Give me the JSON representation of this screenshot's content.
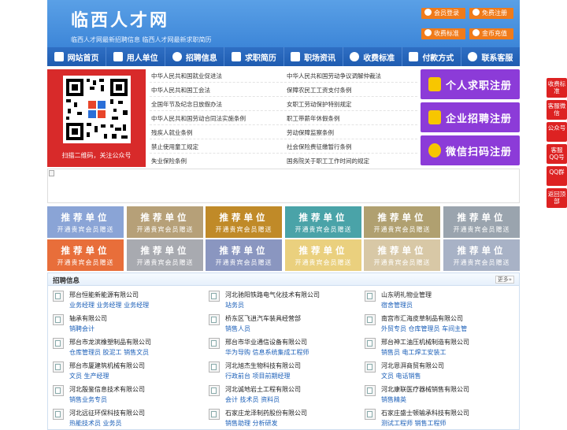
{
  "header": {
    "title": "临西人才网",
    "subtitle": "临西人才网最新招聘信息   临西人才网最新求职简历",
    "buttons": [
      {
        "label": "会员登录",
        "icon": "user-icon"
      },
      {
        "label": "免费注册",
        "icon": "register-icon"
      },
      {
        "label": "收费标准",
        "icon": "yen-icon"
      },
      {
        "label": "金币充值",
        "icon": "coin-icon"
      }
    ]
  },
  "nav": {
    "items": [
      {
        "label": "网站首页",
        "icon": "home-icon"
      },
      {
        "label": "用人单位",
        "icon": "building-icon"
      },
      {
        "label": "招聘信息",
        "icon": "person-icon"
      },
      {
        "label": "求职简历",
        "icon": "resume-icon"
      },
      {
        "label": "职场资讯",
        "icon": "news-icon"
      },
      {
        "label": "收费标准",
        "icon": "yen-icon"
      },
      {
        "label": "付款方式",
        "icon": "card-icon"
      },
      {
        "label": "联系客服",
        "icon": "phone-icon"
      }
    ]
  },
  "qr": {
    "caption": "扫描二维码，关注公众号"
  },
  "laws": [
    [
      "中华人民共和国就业促进法",
      "中华人民共和国劳动争议调解仲裁法"
    ],
    [
      "中华人民共和国工会法",
      "保障农民工工资支付条例"
    ],
    [
      "全国年节及纪念日放假办法",
      "女职工劳动保护特别规定"
    ],
    [
      "中华人民共和国劳动合同法实施条例",
      "职工带薪年休假条例"
    ],
    [
      "残疾人就业条例",
      "劳动保障监察条例"
    ],
    [
      "禁止使用童工规定",
      "社会保险费征缴暂行条例"
    ],
    [
      "失业保险条例",
      "国务院关于职工工作时间的规定"
    ]
  ],
  "register": [
    {
      "label": "个人求职注册",
      "icon": "person-register-icon"
    },
    {
      "label": "企业招聘注册",
      "icon": "company-register-icon"
    },
    {
      "label": "微信扫码注册",
      "icon": "wechat-icon"
    }
  ],
  "tiles": {
    "title": "推荐单位",
    "subtitle": "开通贵宾会员赠送",
    "colors": [
      "#8aa4d6",
      "#b6a078",
      "#c08a28",
      "#4aa3a8",
      "#b0a070",
      "#9aa4ae",
      "#e86e3a",
      "#a8aab0",
      "#8a96c0",
      "#ead07e",
      "#d8c8a6",
      "#a8b2c6"
    ]
  },
  "jobs": {
    "title": "招聘信息",
    "more": "更多»",
    "items": [
      {
        "company": "邢台恒能新能源有限公司",
        "positions": "业务经理 业务经理 业务经理"
      },
      {
        "company": "河北驰阳铁路电气化技术有限公司",
        "positions": "站务员"
      },
      {
        "company": "山东明礼物业管理",
        "positions": "宿舍管理员"
      },
      {
        "company": "轴承有限公司",
        "positions": "销聘会计"
      },
      {
        "company": "桥东区飞逍汽车装具经营部",
        "positions": "销售人员"
      },
      {
        "company": "南宫市汇海皮草制品有限公司",
        "positions": "外贸专员 仓库管理员 车间主管"
      },
      {
        "company": "邢台市龙滨橡塑制品有限公司",
        "positions": "仓库管理员 胶泥工 销售文员"
      },
      {
        "company": "邢台市华业通信设备有限公司",
        "positions": "华为导购 信息系统集成工程师"
      },
      {
        "company": "邢台神工油压机械制造有限公司",
        "positions": "销售员 电工焊工安装工"
      },
      {
        "company": "邢台市厦建筑机械有限公司",
        "positions": "文员 生产经理"
      },
      {
        "company": "河北旭杰生物科技有限公司",
        "positions": "行政前台 项目前期经理"
      },
      {
        "company": "河北恩湃商贸有限公司",
        "positions": "文员 电话销售"
      },
      {
        "company": "河北殷鉴信息技术有限公司",
        "positions": "销售业务专员"
      },
      {
        "company": "河北诚地岩土工程有限公司",
        "positions": "会计 技术员 资料员"
      },
      {
        "company": "河北康联医疗器械销售有限公司",
        "positions": "销售精英"
      },
      {
        "company": "河北远征环保科技有限公司",
        "positions": "热能技术员 业务员"
      },
      {
        "company": "石家庄龙泽制药股份有限公司",
        "positions": "销售助理 分析研发"
      },
      {
        "company": "石家庄盛士顿输承科技有限公司",
        "positions": "测试工程师 销售工程师"
      }
    ]
  },
  "float": [
    "收费标准",
    "客服微信",
    "公众号",
    "客服QQ号",
    "QQ群",
    "返回顶部"
  ]
}
